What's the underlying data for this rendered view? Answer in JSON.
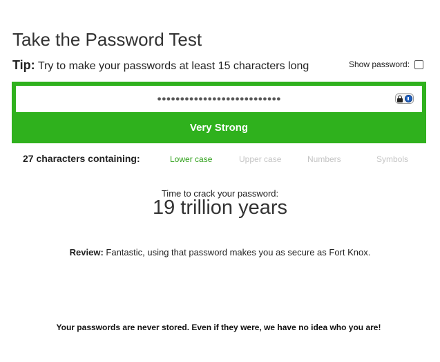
{
  "page": {
    "title": "Take the Password Test",
    "tip_label": "Tip:",
    "tip_text": " Try to make your passwords at least 15 characters long"
  },
  "show_password": {
    "label": "Show password:",
    "checked": false
  },
  "password_field": {
    "masked_value": "●●●●●●●●●●●●●●●●●●●●●●●●●●●",
    "icons": [
      "lock-icon",
      "password-manager-key-icon"
    ]
  },
  "strength": {
    "label": "Very Strong",
    "color": "#2fb11d"
  },
  "characters": {
    "summary": "27 characters containing:",
    "types": [
      {
        "label": "Lower case",
        "active": true
      },
      {
        "label": "Upper case",
        "active": false
      },
      {
        "label": "Numbers",
        "active": false
      },
      {
        "label": "Symbols",
        "active": false
      }
    ],
    "active_color": "#2fa01a",
    "inactive_color": "#c4c4c4"
  },
  "crack": {
    "label": "Time to crack your password:",
    "value": "19 trillion years"
  },
  "review": {
    "label": "Review:",
    "text": " Fantastic, using that password makes you as secure as Fort Knox."
  },
  "footer": {
    "note": "Your passwords are never stored. Even if they were, we have no idea who you are!"
  }
}
